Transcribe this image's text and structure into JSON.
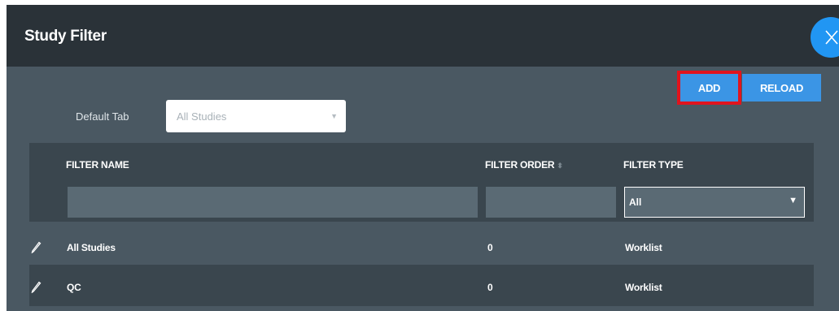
{
  "dialog": {
    "title": "Study Filter",
    "close_icon": "close-icon"
  },
  "toolbar": {
    "add_label": "ADD",
    "reload_label": "RELOAD"
  },
  "default_tab": {
    "label": "Default Tab",
    "value": "All Studies"
  },
  "table": {
    "columns": [
      "FILTER NAME",
      "FILTER ORDER",
      "FILTER TYPE"
    ],
    "filters": {
      "name": "",
      "order": "",
      "type": "All"
    },
    "rows": [
      {
        "name": "All Studies",
        "order": "0",
        "type": "Worklist"
      },
      {
        "name": "QC",
        "order": "0",
        "type": "Worklist"
      }
    ]
  },
  "colors": {
    "header_bg": "#2a3238",
    "body_bg": "#4a5862",
    "accent": "#3b95e5",
    "highlight": "#e0141e"
  }
}
